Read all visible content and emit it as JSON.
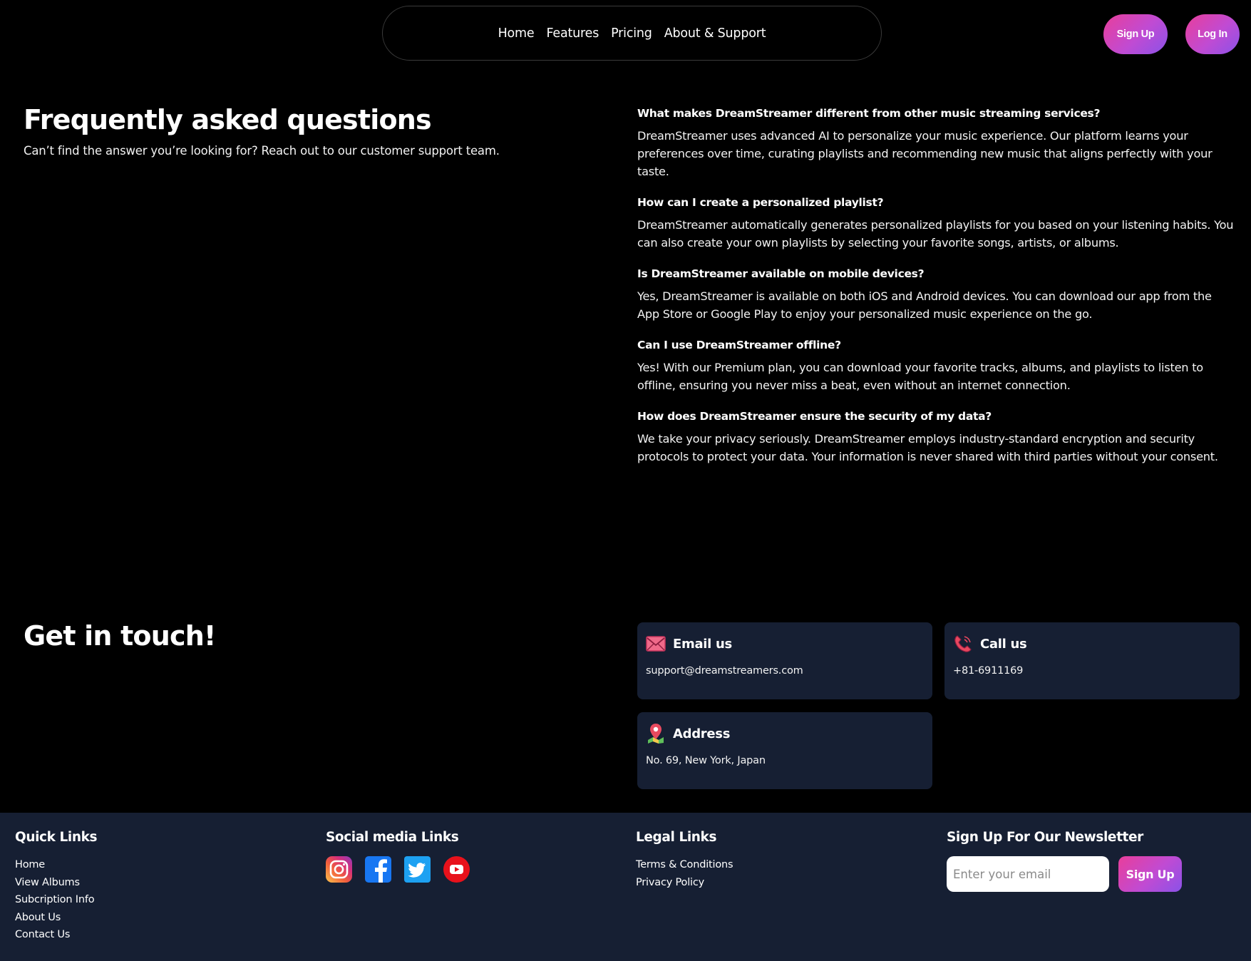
{
  "nav": {
    "links": [
      "Home",
      "Features",
      "Pricing",
      "About & Support"
    ],
    "signup_label": "Sign Up",
    "login_label": "Log In"
  },
  "faq": {
    "title": "Frequently asked questions",
    "subtitle": "Can’t find the answer you’re looking for? Reach out to our customer support team.",
    "items": [
      {
        "q": "What makes DreamStreamer different from other music streaming services?",
        "a": "DreamStreamer uses advanced AI to personalize your music experience. Our platform learns your preferences over time, curating playlists and recommending new music that aligns perfectly with your taste."
      },
      {
        "q": "How can I create a personalized playlist?",
        "a": "DreamStreamer automatically generates personalized playlists for you based on your listening habits. You can also create your own playlists by selecting your favorite songs, artists, or albums."
      },
      {
        "q": "Is DreamStreamer available on mobile devices?",
        "a": "Yes, DreamStreamer is available on both iOS and Android devices. You can download our app from the App Store or Google Play to enjoy your personalized music experience on the go."
      },
      {
        "q": "Can I use DreamStreamer offline?",
        "a": "Yes! With our Premium plan, you can download your favorite tracks, albums, and playlists to listen to offline, ensuring you never miss a beat, even without an internet connection."
      },
      {
        "q": "How does DreamStreamer ensure the security of my data?",
        "a": "We take your privacy seriously. DreamStreamer employs industry-standard encryption and security protocols to protect your data. Your information is never shared with third parties without your consent."
      }
    ]
  },
  "contact": {
    "title": "Get in touch!",
    "email": {
      "label": "Email us",
      "value": "support@dreamstreamers.com",
      "icon": "envelope-icon"
    },
    "call": {
      "label": "Call us",
      "value": "+81-6911169",
      "icon": "phone-icon"
    },
    "address": {
      "label": "Address",
      "value": "No. 69, New York, Japan",
      "icon": "map-pin-icon"
    }
  },
  "footer": {
    "quick_links": {
      "title": "Quick Links",
      "items": [
        "Home",
        "View Albums",
        "Subcription Info",
        "About Us",
        "Contact Us"
      ]
    },
    "social": {
      "title": "Social media Links",
      "icons": [
        "instagram-icon",
        "facebook-icon",
        "twitter-icon",
        "youtube-icon"
      ]
    },
    "legal": {
      "title": "Legal Links",
      "items": [
        "Terms & Conditions",
        "Privacy Policy"
      ]
    },
    "newsletter": {
      "title": "Sign Up For Our Newsletter",
      "placeholder": "Enter your email",
      "button": "Sign Up"
    }
  },
  "colors": {
    "background": "#000000",
    "card": "#161f33",
    "gradient_start": "#e93e9a",
    "gradient_end": "#8a52e8"
  }
}
